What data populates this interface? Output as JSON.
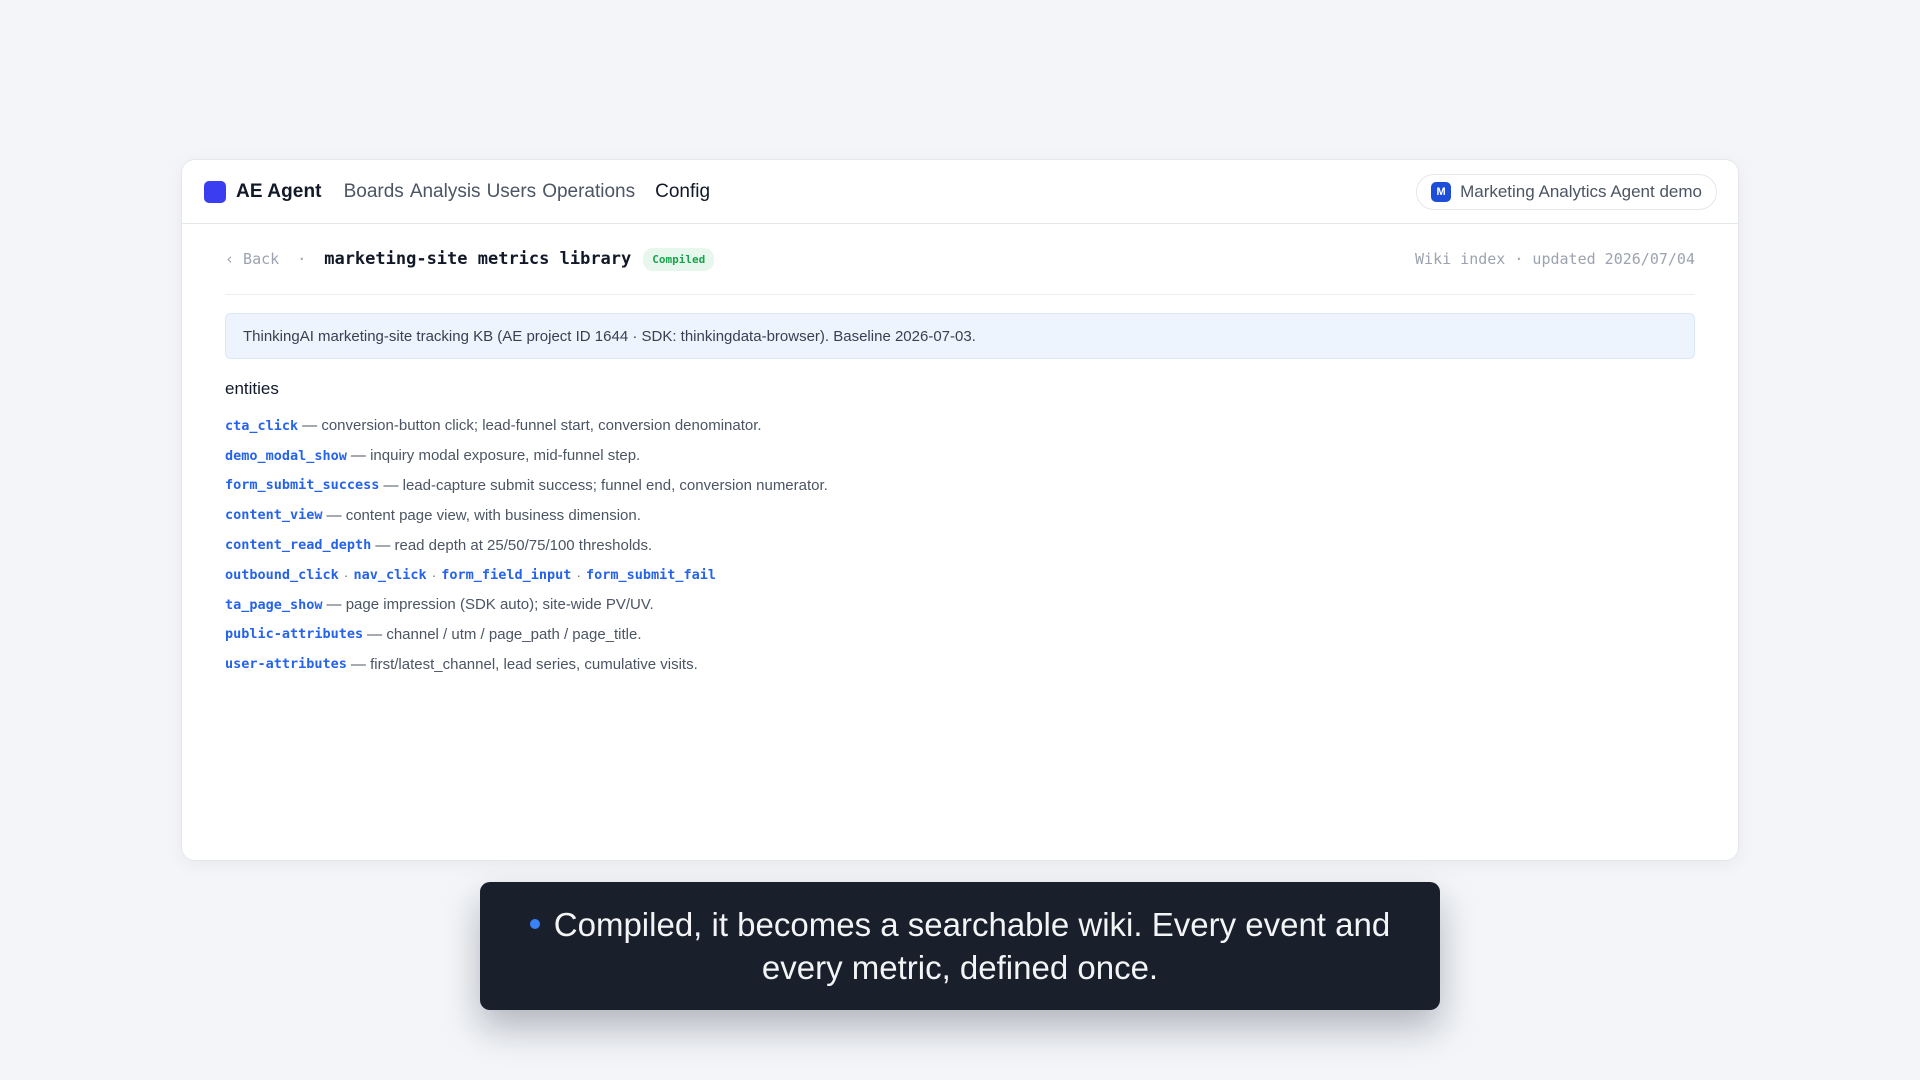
{
  "app": {
    "brand": "AE Agent",
    "nav": [
      "Boards",
      "Analysis",
      "Users",
      "Operations"
    ],
    "active_nav": "Config",
    "project": {
      "avatar": "M",
      "name": "Marketing Analytics Agent demo"
    }
  },
  "page": {
    "back_label": "‹ Back",
    "separator": "·",
    "title": "marketing-site metrics library",
    "status": "Compiled",
    "meta": "Wiki index · updated 2026/07/04",
    "summary": "ThinkingAI marketing-site tracking KB (AE project ID 1644 · SDK: thinkingdata-browser). Baseline 2026-07-03."
  },
  "section": {
    "heading": "entities"
  },
  "entities": [
    {
      "name": "cta_click",
      "desc": "— conversion-button click; lead-funnel start, conversion denominator."
    },
    {
      "name": "demo_modal_show",
      "desc": "— inquiry modal exposure, mid-funnel step."
    },
    {
      "name": "form_submit_success",
      "desc": "— lead-capture submit success; funnel end, conversion numerator."
    },
    {
      "name": "content_view",
      "desc": "— content page view, with business dimension."
    },
    {
      "name": "content_read_depth",
      "desc": "— read depth at 25/50/75/100 thresholds."
    },
    {
      "names": [
        "outbound_click",
        "nav_click",
        "form_field_input",
        "form_submit_fail"
      ],
      "joiner": "·"
    },
    {
      "name": "ta_page_show",
      "desc": "— page impression (SDK auto); site-wide PV/UV."
    },
    {
      "name": "public-attributes",
      "desc": "— channel / utm / page_path / page_title."
    },
    {
      "name": "user-attributes",
      "desc": "— first/latest_channel, lead series, cumulative visits."
    }
  ],
  "caption": {
    "text": "Compiled, it becomes a searchable wiki. Every event and every metric, defined once."
  },
  "colors": {
    "brand": "#3b3df0",
    "link": "#2563eb",
    "status_green": "#16a34a",
    "caption_bg": "#1a1f2c",
    "caption_dot": "#3b82f6"
  }
}
